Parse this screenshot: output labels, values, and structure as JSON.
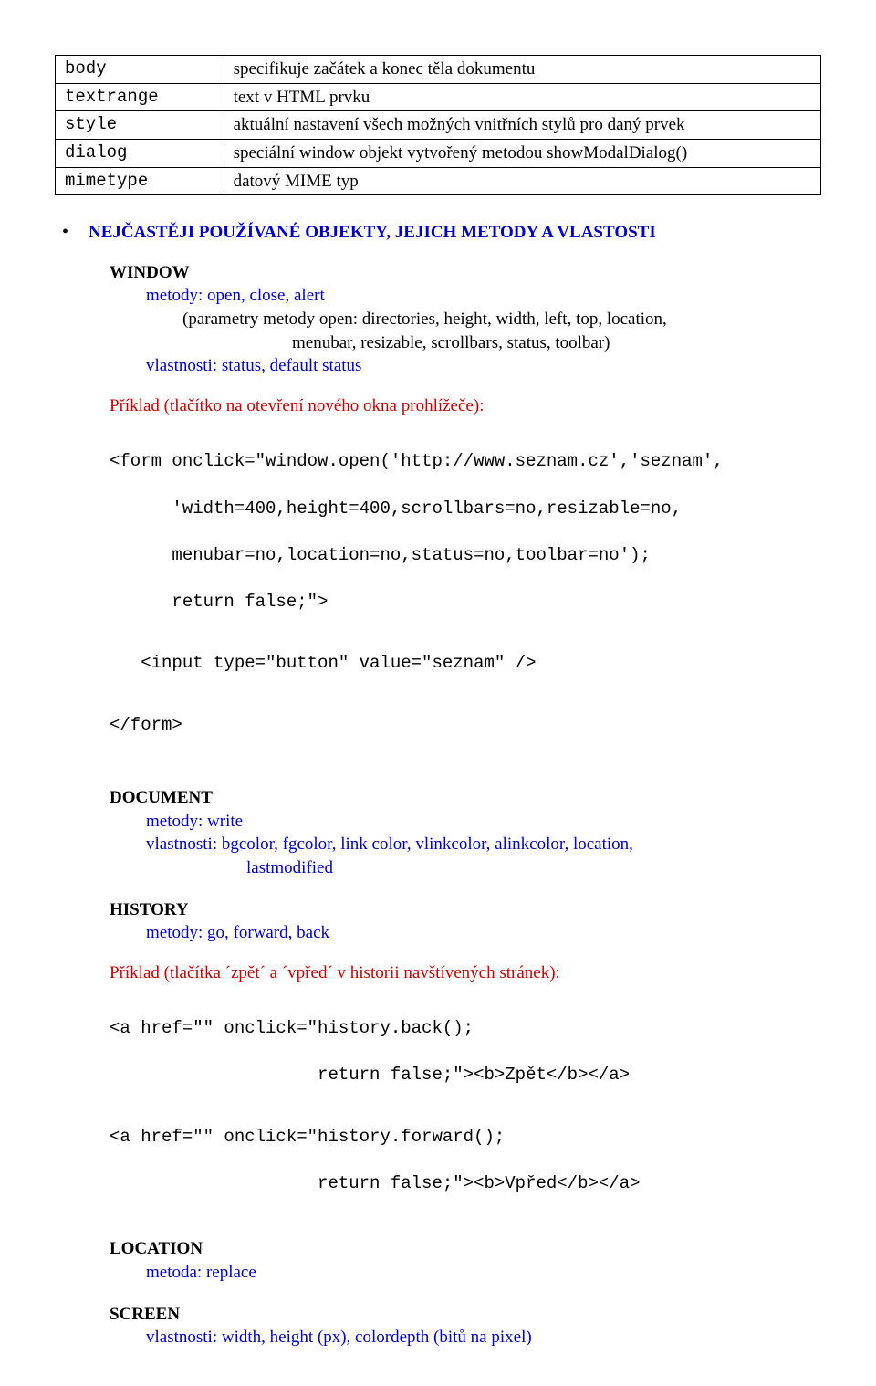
{
  "defs": [
    {
      "term": "body",
      "desc": "specifikuje začátek a konec těla dokumentu"
    },
    {
      "term": "textrange",
      "desc": "text v HTML prvku"
    },
    {
      "term": "style",
      "desc": "aktuální nastavení všech možných vnitřních stylů pro daný prvek"
    },
    {
      "term": "dialog",
      "desc": "speciální window objekt vytvořený metodou showModalDialog()"
    },
    {
      "term": "mimetype",
      "desc": "datový MIME typ"
    }
  ],
  "heading": "NEJČASTĚJI POUŽÍVANÉ OBJEKTY, JEJICH METODY A VLASTOSTI",
  "window": {
    "name": "WINDOW",
    "methods": "metody: open, close, alert",
    "params1": "(parametry metody open: directories, height, width, left, top, location,",
    "params2": "menubar, resizable, scrollbars, status, toolbar)",
    "props": "vlastnosti: status, default status"
  },
  "example1": {
    "lead": "Příklad (tlačítko na otevření nového okna prohlížeče):",
    "code1": "<form onclick=\"window.open('http://www.seznam.cz','seznam',",
    "code2": "      'width=400,height=400,scrollbars=no,resizable=no,",
    "code3": "      menubar=no,location=no,status=no,toolbar=no');",
    "code4": "      return false;\">",
    "code5": "   <input type=\"button\" value=\"seznam\" />",
    "code6": "</form>"
  },
  "document": {
    "name": "DOCUMENT",
    "methods": "metody: write",
    "props1": "vlastnosti: bgcolor, fgcolor, link color, vlinkcolor, alinkcolor, location,",
    "props2": "lastmodified"
  },
  "history": {
    "name": "HISTORY",
    "methods": "metody: go, forward, back"
  },
  "example2": {
    "lead": "Příklad (tlačítka ´zpět´ a ´vpřed´ v historii navštívených stránek):",
    "code1": "<a href=\"\" onclick=\"history.back();",
    "code2": "                    return false;\"><b>Zpět</b></a>",
    "code3": "<a href=\"\" onclick=\"history.forward();",
    "code4": "                    return false;\"><b>Vpřed</b></a>"
  },
  "location": {
    "name": "LOCATION",
    "method": "metoda: replace"
  },
  "screen": {
    "name": "SCREEN",
    "props": "vlastnosti: width, height (px), colordepth (bitů na pixel)"
  }
}
